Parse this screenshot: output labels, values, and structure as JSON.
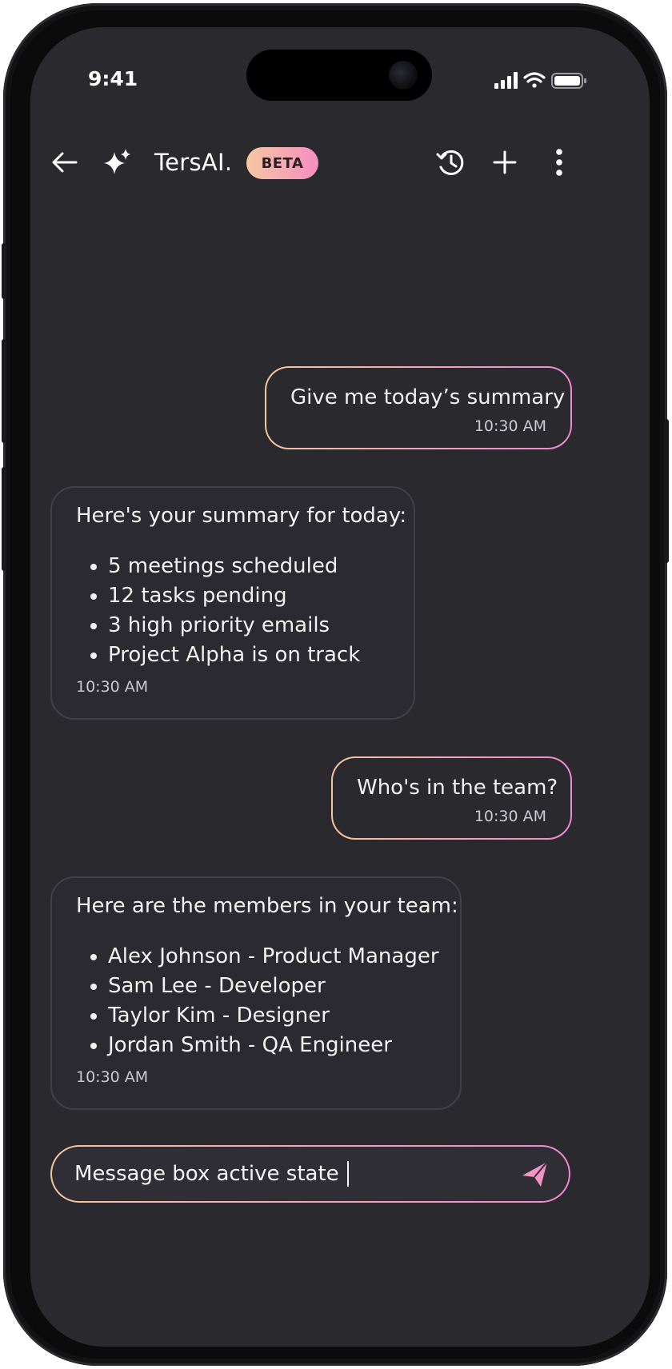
{
  "status_bar": {
    "time": "9:41"
  },
  "header": {
    "app_name": "TersAI.",
    "badge": "BETA"
  },
  "icons": {
    "back": "arrow-left-icon",
    "sparkle": "sparkle-icon",
    "history": "history-icon",
    "new_chat": "plus-icon",
    "more": "more-vertical-icon",
    "send": "send-icon",
    "signal": "signal-icon",
    "wifi": "wifi-icon",
    "battery": "battery-icon"
  },
  "colors": {
    "screen_bg": "#2a292e",
    "gradient_start": "#f2c59c",
    "gradient_end": "#ee88cf",
    "bot_border": "#414046"
  },
  "messages": [
    {
      "role": "user",
      "text": "Give me today’s summary",
      "time": "10:30 AM"
    },
    {
      "role": "assistant",
      "text": "Here's your summary for today:",
      "items": [
        "5 meetings scheduled",
        "12 tasks pending",
        "3 high priority emails",
        "Project Alpha is on track"
      ],
      "time": "10:30 AM"
    },
    {
      "role": "user",
      "text": "Who's in the team?",
      "time": "10:30 AM"
    },
    {
      "role": "assistant",
      "text": "Here are the members in your team:",
      "items": [
        "Alex Johnson - Product Manager",
        "Sam Lee - Developer",
        "Taylor Kim - Designer",
        "Jordan Smith - QA Engineer"
      ],
      "time": "10:30 AM"
    }
  ],
  "composer": {
    "value": "Message box active state"
  }
}
